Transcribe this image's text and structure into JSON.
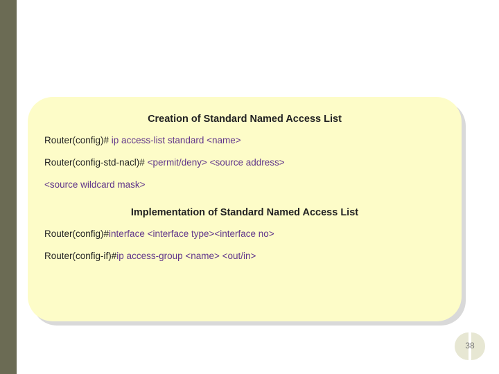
{
  "card": {
    "title": "Creation of Standard Named Access List",
    "line1": {
      "prompt": "Router(config)#",
      "cmd": " ip access-list standard <name>"
    },
    "line2": {
      "prompt": "Router(config-std-nacl)#",
      "cmd": " <permit/deny> <source address>"
    },
    "line3": {
      "cmd": "<source wildcard mask>"
    },
    "subtitle": "Implementation of Standard Named Access List",
    "line4": {
      "prompt": "Router(config)#",
      "cmd": "interface <interface type><interface no>"
    },
    "line5": {
      "prompt": "Router(config-if)#",
      "cmd": "ip access-group <name> <out/in>"
    }
  },
  "page_number": "38"
}
